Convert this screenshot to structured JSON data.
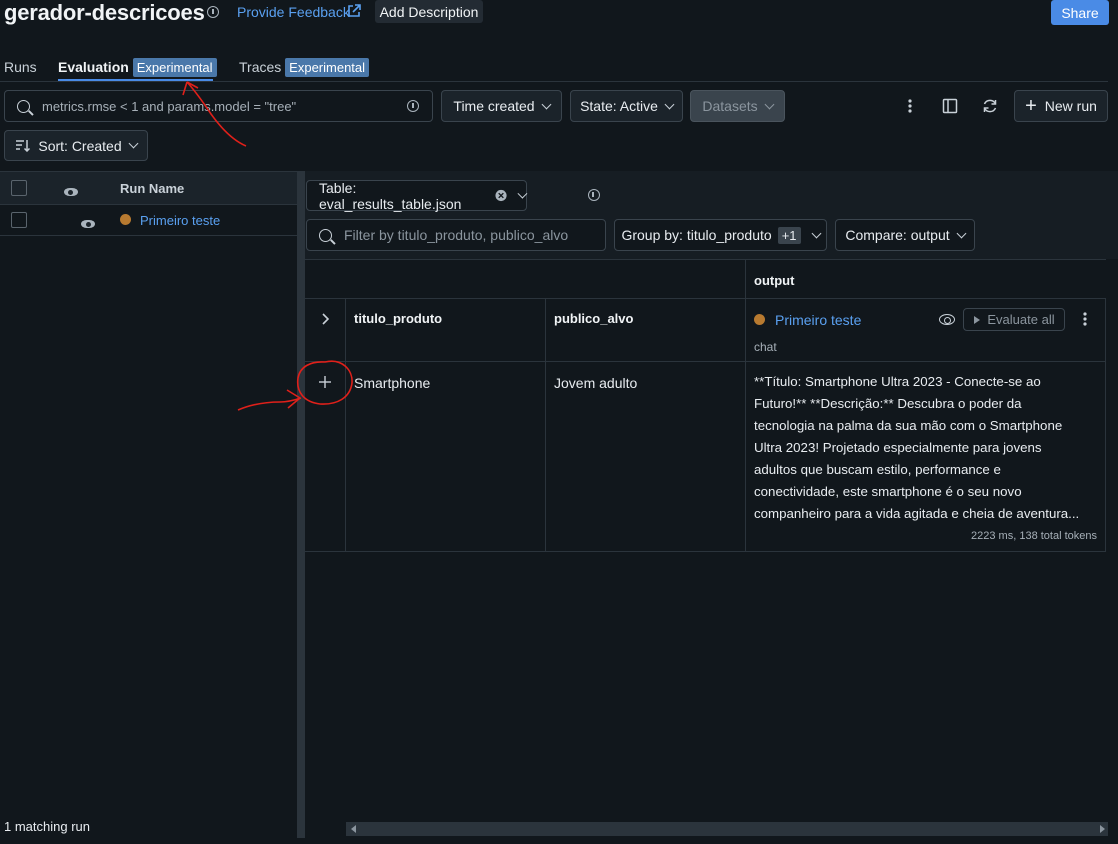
{
  "header": {
    "title": "gerador-descricoes",
    "feedback_label": "Provide Feedback",
    "add_description_label": "Add Description",
    "share_label": "Share"
  },
  "tabs": [
    {
      "label": "Runs",
      "badge": ""
    },
    {
      "label": "Evaluation",
      "badge": "Experimental",
      "active": true
    },
    {
      "label": "Traces",
      "badge": "Experimental"
    }
  ],
  "toolbar": {
    "search_value": "metrics.rmse < 1 and params.model = \"tree\"",
    "time_label": "Time created",
    "state_label": "State: Active",
    "datasets_label": "Datasets",
    "new_run_label": "New run",
    "sort_label": "Sort: Created"
  },
  "runs_table": {
    "col_run_name": "Run Name",
    "rows": [
      {
        "name": "Primeiro teste",
        "color": "#b87a30"
      }
    ],
    "footer": "1 matching run"
  },
  "evaluation": {
    "table_label": "Table: eval_results_table.json",
    "filter_placeholder": "Filter by titulo_produto, publico_alvo",
    "group_by_label": "Group by: titulo_produto",
    "group_by_extra": "+1",
    "compare_label": "Compare: output",
    "output_header": "output",
    "col_titulo": "titulo_produto",
    "col_publico": "publico_alvo",
    "run_name": "Primeiro teste",
    "evaluate_all_label": "Evaluate all",
    "run_type": "chat",
    "rows": [
      {
        "titulo_produto": "Smartphone",
        "publico_alvo": "Jovem adulto",
        "output_lines": [
          "**Título: Smartphone Ultra 2023 - Conecte-se ao",
          "Futuro!** **Descrição:** Descubra o poder da",
          "tecnologia na palma da sua mão com o Smartphone",
          "Ultra 2023! Projetado especialmente para jovens",
          "adultos que buscam estilo, performance e",
          "conectividade, este smartphone é o seu novo",
          "companheiro para a vida agitada e cheia de aventura..."
        ],
        "output_meta": "2223 ms, 138 total tokens"
      }
    ]
  },
  "colors": {
    "background": "#11171c",
    "accent": "#4a8be6",
    "link": "#5aa0f0",
    "badge": "#4a78aa",
    "annotation": "#e0201a"
  }
}
